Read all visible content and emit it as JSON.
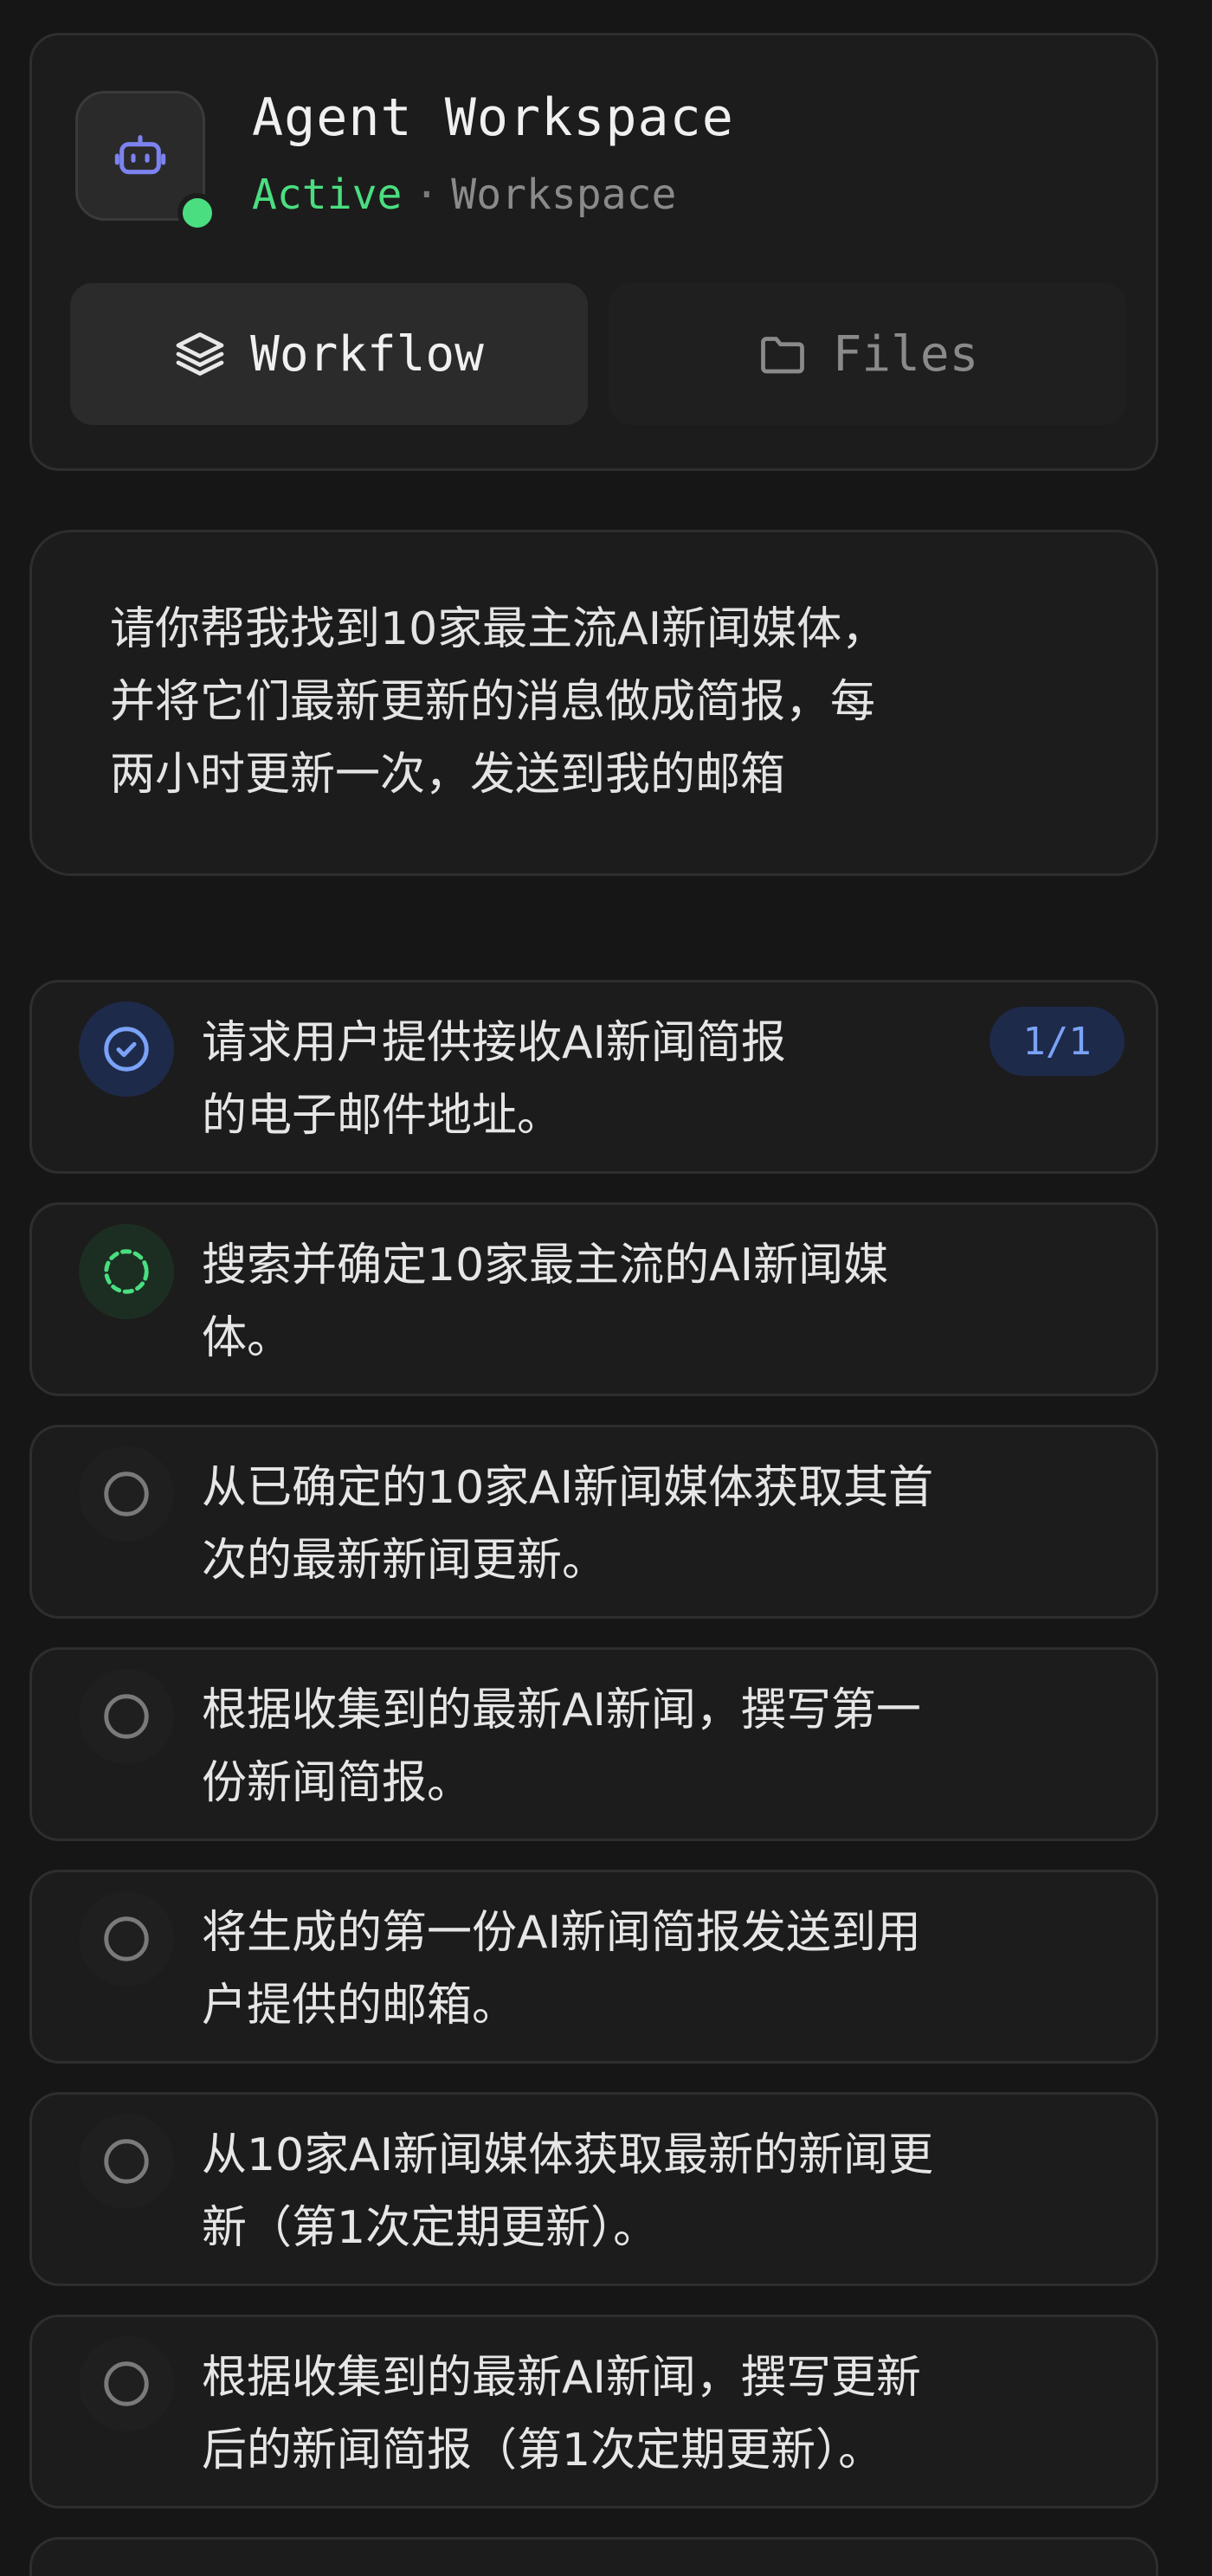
{
  "header": {
    "title": "Agent Workspace",
    "status": "Active",
    "separator": "·",
    "kind": "Workspace",
    "avatar_icon": "bot-icon",
    "colors": {
      "active": "#4ade80",
      "accent": "#7aa2f7",
      "avatar_icon": "#7c83f0"
    }
  },
  "tabs": [
    {
      "label": "Workflow",
      "icon": "layers-icon",
      "active": true
    },
    {
      "label": "Files",
      "icon": "folder-icon",
      "active": false
    }
  ],
  "prompt": {
    "lines": [
      "请你帮我找到10家最主流AI新闻媒体，",
      "并将它们最新更新的消息做成简报，每",
      "两小时更新一次，发送到我的邮箱"
    ]
  },
  "tasks": [
    {
      "status": "done",
      "icon": "check-circle-icon",
      "lines": [
        "请求用户提供接收AI新闻简报",
        "的电子邮件地址。"
      ],
      "badge": "1/1"
    },
    {
      "status": "running",
      "icon": "spinner-dashed-icon",
      "lines": [
        "搜索并确定10家最主流的AI新闻媒",
        "体。"
      ]
    },
    {
      "status": "pending",
      "icon": "empty-circle-icon",
      "lines": [
        "从已确定的10家AI新闻媒体获取其首",
        "次的最新新闻更新。"
      ]
    },
    {
      "status": "pending",
      "icon": "empty-circle-icon",
      "lines": [
        "根据收集到的最新AI新闻，撰写第一",
        "份新闻简报。"
      ]
    },
    {
      "status": "pending",
      "icon": "empty-circle-icon",
      "lines": [
        "将生成的第一份AI新闻简报发送到用",
        "户提供的邮箱。"
      ]
    },
    {
      "status": "pending",
      "icon": "empty-circle-icon",
      "lines": [
        "从10家AI新闻媒体获取最新的新闻更",
        "新（第1次定期更新）。"
      ]
    },
    {
      "status": "pending",
      "icon": "empty-circle-icon",
      "lines": [
        "根据收集到的最新AI新闻，撰写更新",
        "后的新闻简报（第1次定期更新）。"
      ]
    }
  ]
}
